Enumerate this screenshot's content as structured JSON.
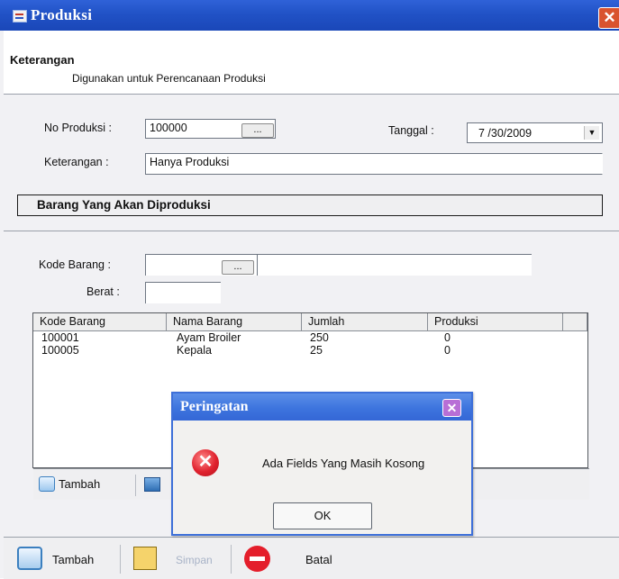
{
  "window": {
    "title": "Produksi",
    "close_label": "✕"
  },
  "header": {
    "title": "Keterangan",
    "subtitle": "Digunakan untuk Perencanaan Produksi"
  },
  "form": {
    "no_produksi_label": "No Produksi :",
    "no_produksi_value": "100000",
    "browse_label": "...",
    "tanggal_label": "Tanggal :",
    "tanggal_value": "7 /30/2009",
    "keterangan_label": "Keterangan :",
    "keterangan_value": "Hanya Produksi"
  },
  "section": {
    "title": "Barang Yang Akan Diproduksi"
  },
  "item_form": {
    "kode_barang_label": "Kode Barang :",
    "kode_barang_value": "",
    "browse_label": "...",
    "nama_barang_value": "",
    "berat_label": "Berat :",
    "berat_value": ""
  },
  "table": {
    "columns": [
      "Kode Barang",
      "Nama Barang",
      "Jumlah",
      "Produksi"
    ],
    "rows": [
      [
        "100001",
        "Ayam Broiler",
        "250",
        "0"
      ],
      [
        "100005",
        "Kepala",
        "25",
        "0"
      ]
    ]
  },
  "item_toolbar": {
    "tambah_label": "Tambah"
  },
  "toolbar": {
    "tambah_label": "Tambah",
    "simpan_label": "Simpan",
    "batal_label": "Batal"
  },
  "dialog": {
    "title": "Peringatan",
    "message": "Ada Fields Yang Masih Kosong",
    "ok_label": "OK",
    "close_label": "✕",
    "icon": "error-icon"
  },
  "colors": {
    "titlebar": "#2152c6",
    "dialog_titlebar": "#3d74de",
    "error_red": "#e0222e",
    "panel_bg": "#f1f1f4"
  }
}
